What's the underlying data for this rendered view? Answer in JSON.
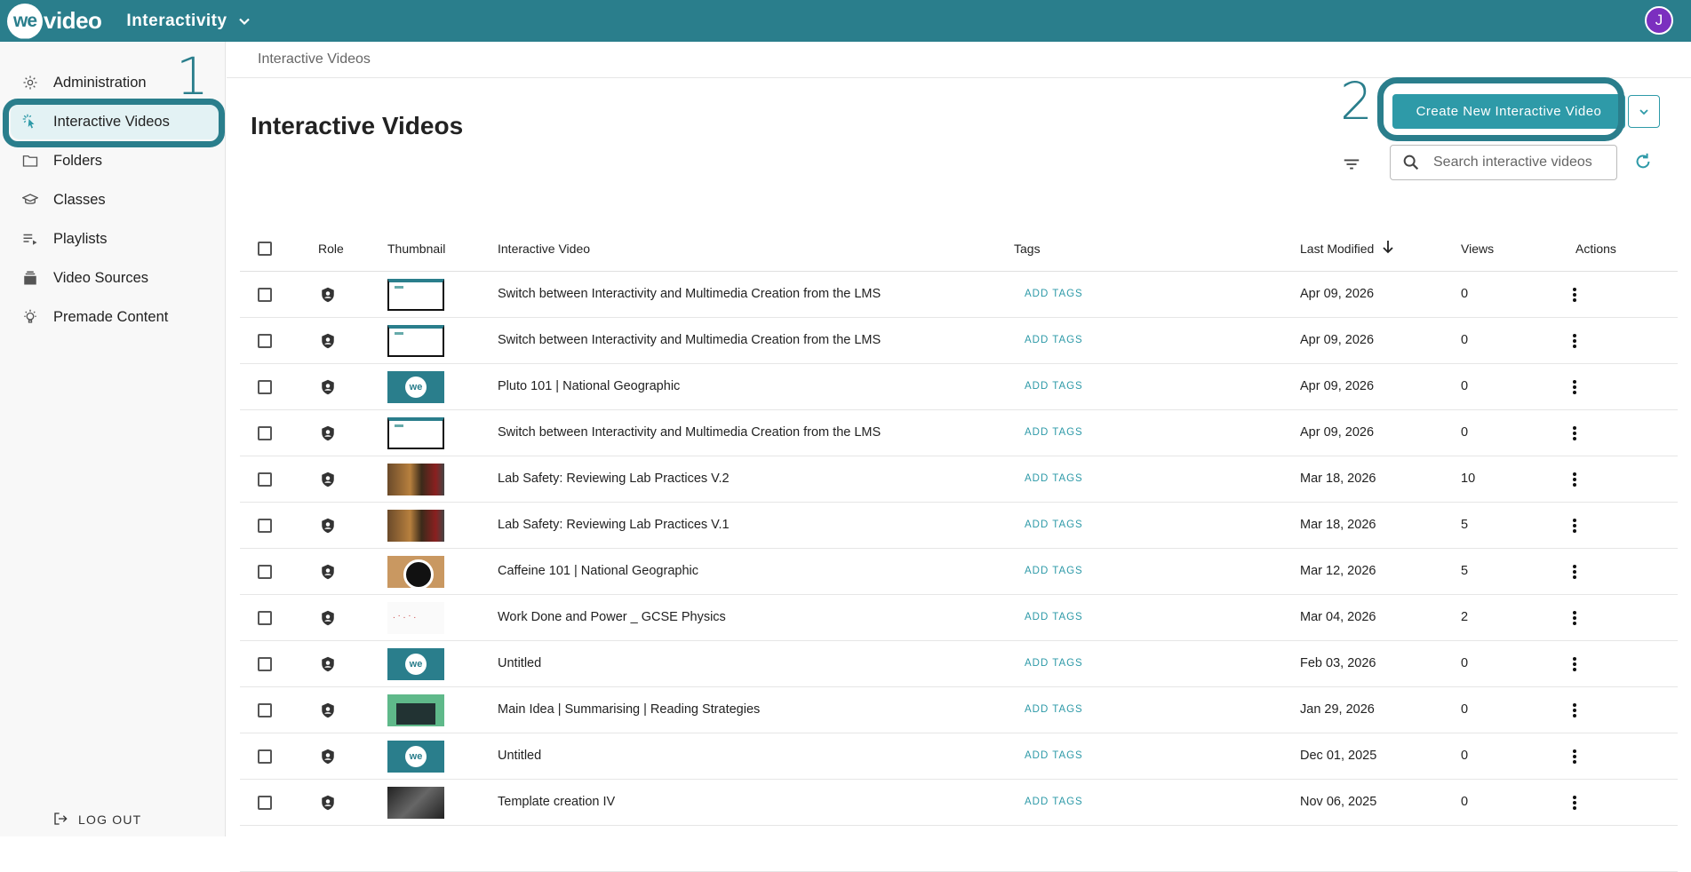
{
  "topbar": {
    "logo_we": "we",
    "logo_text": "video",
    "app_name": "Interactivity",
    "avatar_initial": "J"
  },
  "sidebar": {
    "items": [
      {
        "label": "Administration",
        "icon": "gear-icon"
      },
      {
        "label": "Interactive Videos",
        "icon": "cursor-click-icon",
        "active": true
      },
      {
        "label": "Folders",
        "icon": "folder-icon"
      },
      {
        "label": "Classes",
        "icon": "graduation-cap-icon"
      },
      {
        "label": "Playlists",
        "icon": "playlist-icon"
      },
      {
        "label": "Video Sources",
        "icon": "video-sources-icon"
      },
      {
        "label": "Premade Content",
        "icon": "lightbulb-icon"
      }
    ],
    "logout_label": "LOG OUT"
  },
  "annotations": {
    "step1": "1",
    "step2": "2"
  },
  "breadcrumb": "Interactive Videos",
  "page_title": "Interactive Videos",
  "actions": {
    "create_label": "Create New Interactive Video",
    "search_placeholder": "Search interactive videos"
  },
  "table": {
    "headers": {
      "role": "Role",
      "thumbnail": "Thumbnail",
      "video": "Interactive Video",
      "tags": "Tags",
      "modified": "Last Modified",
      "views": "Views",
      "actions": "Actions"
    },
    "add_tags_label": "ADD TAGS",
    "rows": [
      {
        "title": "Switch between Interactivity and Multimedia Creation from the LMS",
        "date": "Apr 09, 2026",
        "views": "0",
        "thumb": "screen"
      },
      {
        "title": "Switch between Interactivity and Multimedia Creation from the LMS",
        "date": "Apr 09, 2026",
        "views": "0",
        "thumb": "screen"
      },
      {
        "title": "Pluto 101 | National Geographic",
        "date": "Apr 09, 2026",
        "views": "0",
        "thumb": "we"
      },
      {
        "title": "Switch between Interactivity and Multimedia Creation from the LMS",
        "date": "Apr 09, 2026",
        "views": "0",
        "thumb": "screen"
      },
      {
        "title": "Lab Safety: Reviewing Lab Practices V.2",
        "date": "Mar 18, 2026",
        "views": "10",
        "thumb": "lab"
      },
      {
        "title": "Lab Safety: Reviewing Lab Practices V.1",
        "date": "Mar 18, 2026",
        "views": "5",
        "thumb": "lab"
      },
      {
        "title": "Caffeine 101 | National Geographic",
        "date": "Mar 12, 2026",
        "views": "5",
        "thumb": "coffee"
      },
      {
        "title": "Work Done and Power _ GCSE Physics",
        "date": "Mar 04, 2026",
        "views": "2",
        "thumb": "white"
      },
      {
        "title": "Untitled",
        "date": "Feb 03, 2026",
        "views": "0",
        "thumb": "we"
      },
      {
        "title": "Main Idea | Summarising | Reading Strategies",
        "date": "Jan 29, 2026",
        "views": "0",
        "thumb": "green"
      },
      {
        "title": "Untitled",
        "date": "Dec 01, 2025",
        "views": "0",
        "thumb": "we"
      },
      {
        "title": "Template creation IV",
        "date": "Nov 06, 2025",
        "views": "0",
        "thumb": "dark"
      }
    ]
  }
}
